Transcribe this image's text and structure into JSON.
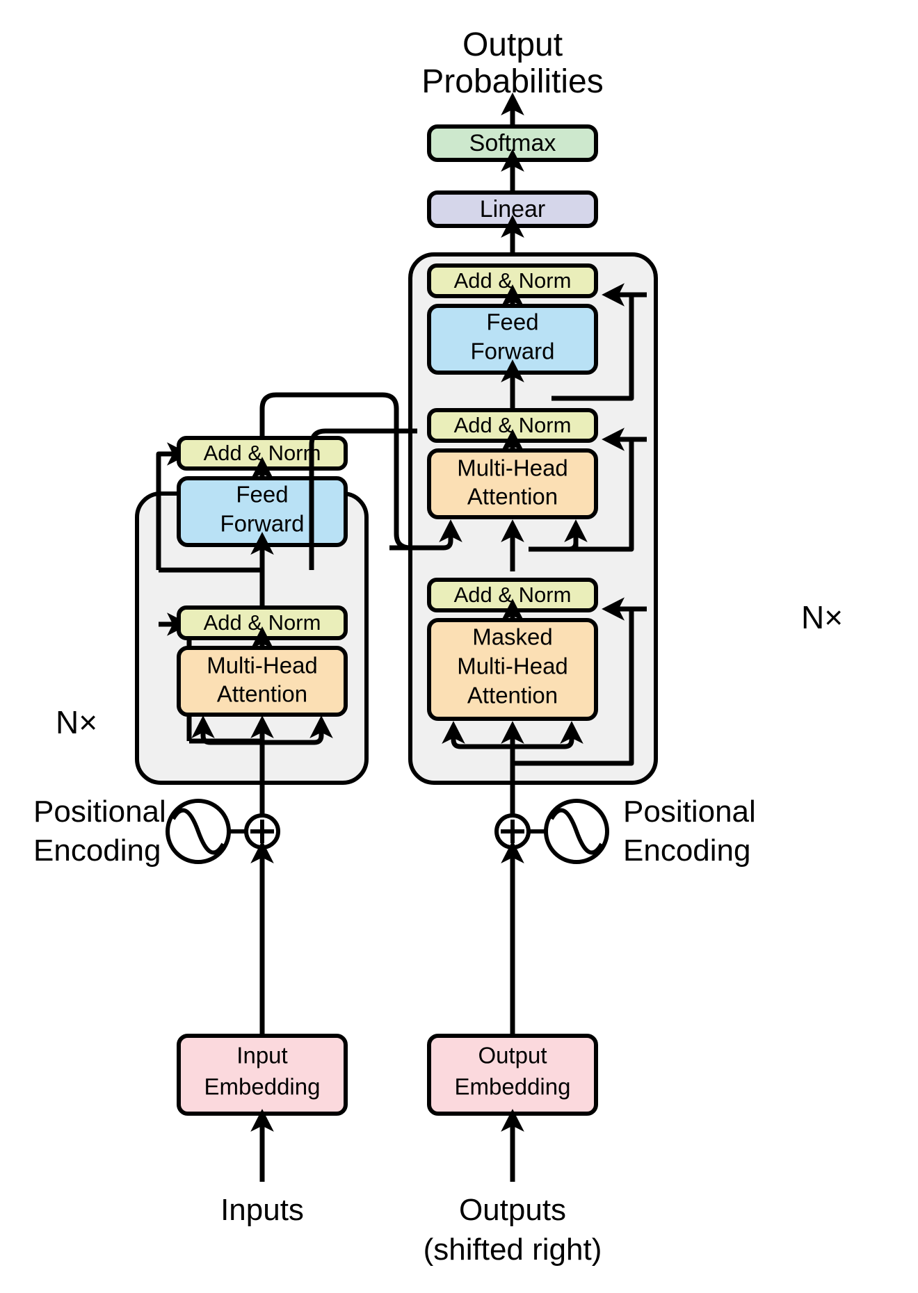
{
  "figure": {
    "title": "Transformer model architecture",
    "top_label_line1": "Output",
    "top_label_line2": "Probabilities",
    "repeat_label": "N×"
  },
  "colors": {
    "softmax": "#cde8cd",
    "linear": "#d5d6ea",
    "add_norm": "#eaeeba",
    "feed_forward": "#b9e1f5",
    "attention": "#fbdfb4",
    "embedding": "#fbd9dd",
    "group_fill": "#f0f0f0",
    "stroke": "#000000"
  },
  "head": {
    "softmax": {
      "label": "Softmax",
      "color_key": "softmax"
    },
    "linear": {
      "label": "Linear",
      "color_key": "linear"
    }
  },
  "encoder": {
    "repeat_label": "N×",
    "blocks": [
      {
        "id": "enc-add-norm-2",
        "label": "Add & Norm",
        "lines": [
          "Add & Norm"
        ],
        "color_key": "add_norm"
      },
      {
        "id": "enc-feed-forward",
        "label": "Feed Forward",
        "lines": [
          "Feed",
          "Forward"
        ],
        "color_key": "feed_forward"
      },
      {
        "id": "enc-add-norm-1",
        "label": "Add & Norm",
        "lines": [
          "Add & Norm"
        ],
        "color_key": "add_norm"
      },
      {
        "id": "enc-multi-head-attention",
        "label": "Multi-Head Attention",
        "lines": [
          "Multi-Head",
          "Attention"
        ],
        "color_key": "attention"
      }
    ],
    "positional_encoding": {
      "line1": "Positional",
      "line2": "Encoding"
    },
    "embedding": {
      "lines": [
        "Input",
        "Embedding"
      ],
      "color_key": "embedding"
    },
    "source_label": {
      "lines": [
        "Inputs"
      ]
    },
    "sum_symbol": "⊕"
  },
  "decoder": {
    "repeat_label": "N×",
    "blocks": [
      {
        "id": "dec-add-norm-3",
        "label": "Add & Norm",
        "lines": [
          "Add & Norm"
        ],
        "color_key": "add_norm"
      },
      {
        "id": "dec-feed-forward",
        "label": "Feed Forward",
        "lines": [
          "Feed",
          "Forward"
        ],
        "color_key": "feed_forward"
      },
      {
        "id": "dec-add-norm-2",
        "label": "Add & Norm",
        "lines": [
          "Add & Norm"
        ],
        "color_key": "add_norm"
      },
      {
        "id": "dec-multi-head-attention",
        "label": "Multi-Head Attention",
        "lines": [
          "Multi-Head",
          "Attention"
        ],
        "color_key": "attention"
      },
      {
        "id": "dec-add-norm-1",
        "label": "Add & Norm",
        "lines": [
          "Add & Norm"
        ],
        "color_key": "add_norm"
      },
      {
        "id": "dec-masked-multi-head-attention",
        "label": "Masked Multi-Head Attention",
        "lines": [
          "Masked",
          "Multi-Head",
          "Attention"
        ],
        "color_key": "attention"
      }
    ],
    "positional_encoding": {
      "line1": "Positional",
      "line2": "Encoding"
    },
    "embedding": {
      "lines": [
        "Output",
        "Embedding"
      ],
      "color_key": "embedding"
    },
    "source_label": {
      "lines": [
        "Outputs",
        "(shifted right)"
      ]
    },
    "sum_symbol": "⊕"
  }
}
